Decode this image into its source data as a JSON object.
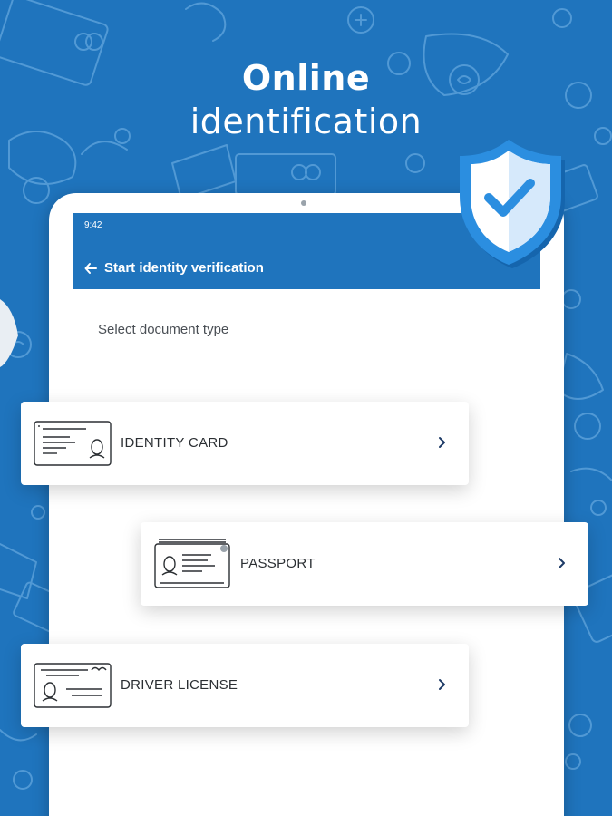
{
  "hero": {
    "title_bold": "Online",
    "title_regular": "identification"
  },
  "app": {
    "status_time": "9:42",
    "appbar_title": "Start identity verification",
    "section_label": "Select document type"
  },
  "documents": [
    {
      "label": "IDENTITY CARD",
      "icon": "identity-card-icon"
    },
    {
      "label": "PASSPORT",
      "icon": "passport-icon"
    },
    {
      "label": "DRIVER LICENSE",
      "icon": "driver-license-icon"
    }
  ],
  "colors": {
    "brand_blue": "#1f74bd",
    "shield_blue": "#2b8ee0",
    "text_dark": "#2b2f33",
    "navy_chevron": "#1d3a66"
  }
}
